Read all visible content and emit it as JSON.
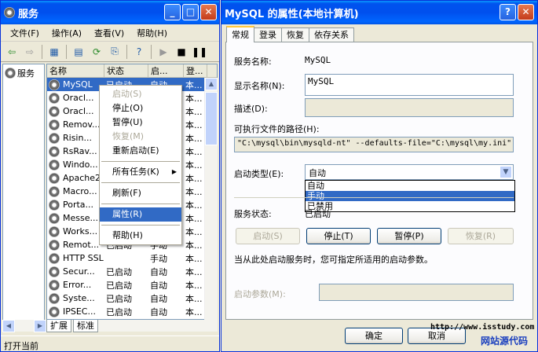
{
  "services_window": {
    "title": "服务",
    "menu": [
      "文件(F)",
      "操作(A)",
      "查看(V)",
      "帮助(H)"
    ],
    "tree_root": "服务",
    "columns": [
      "名称",
      "状态",
      "启...",
      "登..."
    ],
    "rows": [
      {
        "name": "MySQL",
        "status": "已启动",
        "startup": "自动",
        "logon": "本..."
      },
      {
        "name": "Oracl...",
        "status": "",
        "startup": "",
        "logon": "本..."
      },
      {
        "name": "Oracl...",
        "status": "",
        "startup": "",
        "logon": "本..."
      },
      {
        "name": "Remov...",
        "status": "",
        "startup": "",
        "logon": "本..."
      },
      {
        "name": "Risin...",
        "status": "",
        "startup": "",
        "logon": "本..."
      },
      {
        "name": "RsRav...",
        "status": "",
        "startup": "",
        "logon": "本..."
      },
      {
        "name": "Windo...",
        "status": "",
        "startup": "",
        "logon": "本..."
      },
      {
        "name": "Apache2",
        "status": "",
        "startup": "",
        "logon": "本..."
      },
      {
        "name": "Macro...",
        "status": "",
        "startup": "",
        "logon": "本..."
      },
      {
        "name": "Porta...",
        "status": "",
        "startup": "",
        "logon": "本..."
      },
      {
        "name": "Messe...",
        "status": "",
        "startup": "",
        "logon": "本..."
      },
      {
        "name": "Works...",
        "status": "",
        "startup": "",
        "logon": "本..."
      },
      {
        "name": "Remot...",
        "status": "已启动",
        "startup": "手动",
        "logon": "本..."
      },
      {
        "name": "HTTP SSL",
        "status": "",
        "startup": "手动",
        "logon": "本..."
      },
      {
        "name": "Secur...",
        "status": "已启动",
        "startup": "自动",
        "logon": "本..."
      },
      {
        "name": "Error...",
        "status": "已启动",
        "startup": "自动",
        "logon": "本..."
      },
      {
        "name": "Syste...",
        "status": "已启动",
        "startup": "自动",
        "logon": "本..."
      },
      {
        "name": "IPSEC...",
        "status": "已启动",
        "startup": "自动",
        "logon": "本..."
      }
    ],
    "bottom_tabs": [
      "扩展",
      "标准"
    ],
    "status_text": "打开当前"
  },
  "context_menu": {
    "items": [
      {
        "label": "启动(S)",
        "disabled": true
      },
      {
        "label": "停止(O)",
        "disabled": false
      },
      {
        "label": "暂停(U)",
        "disabled": false
      },
      {
        "label": "恢复(M)",
        "disabled": true
      },
      {
        "label": "重新启动(E)",
        "disabled": false
      },
      {
        "label": "所有任务(K)",
        "disabled": false,
        "submenu": true
      },
      {
        "label": "刷新(F)",
        "disabled": false
      },
      {
        "label": "属性(R)",
        "disabled": false,
        "highlight": true
      },
      {
        "label": "帮助(H)",
        "disabled": false
      }
    ]
  },
  "dialog": {
    "title": "MySQL 的属性(本地计算机)",
    "tabs": [
      "常规",
      "登录",
      "恢复",
      "依存关系"
    ],
    "service_name_label": "服务名称:",
    "service_name": "MySQL",
    "display_name_label": "显示名称(N):",
    "display_name": "MySQL",
    "description_label": "描述(D):",
    "exe_path_label": "可执行文件的路径(H):",
    "exe_path": "\"C:\\mysql\\bin\\mysqld-nt\" --defaults-file=\"C:\\mysql\\my.ini\" M",
    "startup_type_label": "启动类型(E):",
    "startup_type": "自动",
    "startup_options": [
      "自动",
      "手动",
      "已禁用"
    ],
    "startup_highlight": "手动",
    "service_status_label": "服务状态:",
    "service_status": "已启动",
    "buttons": {
      "start": "启动(S)",
      "stop": "停止(T)",
      "pause": "暂停(P)",
      "resume": "恢复(R)"
    },
    "hint": "当从此处启动服务时，您可指定所适用的启动参数。",
    "params_label": "启动参数(M):",
    "ok": "确定",
    "cancel": "取消",
    "watermark_url": "http://www.isstudy.com",
    "watermark_text": "网站源代码"
  }
}
